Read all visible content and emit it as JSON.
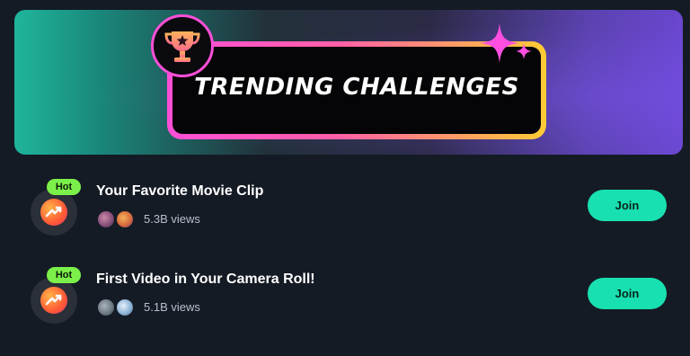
{
  "banner": {
    "title": "TRENDING CHALLENGES",
    "badge_icon": "trophy-icon"
  },
  "challenges": [
    {
      "badge": "Hot",
      "icon": "trending-up-icon",
      "title": "Your Favorite Movie Clip",
      "views": "5.3B views",
      "action": "Join",
      "colors": {
        "avatar1": "#8a4f7a",
        "avatar2": "#d86b3b"
      }
    },
    {
      "badge": "Hot",
      "icon": "trending-up-icon",
      "title": "First Video in Your Camera Roll!",
      "views": "5.1B views",
      "action": "Join",
      "colors": {
        "avatar1": "#6e7a85",
        "avatar2": "#8fb4d8"
      }
    }
  ],
  "colors": {
    "background": "#141b24",
    "accent_join": "#19e0b0",
    "hot_badge": "#7cf04a",
    "banner_left": "#1fb59b",
    "banner_right": "#6a47cf",
    "plate_border_start": "#ff4fd8",
    "plate_border_end": "#ffcc33"
  }
}
